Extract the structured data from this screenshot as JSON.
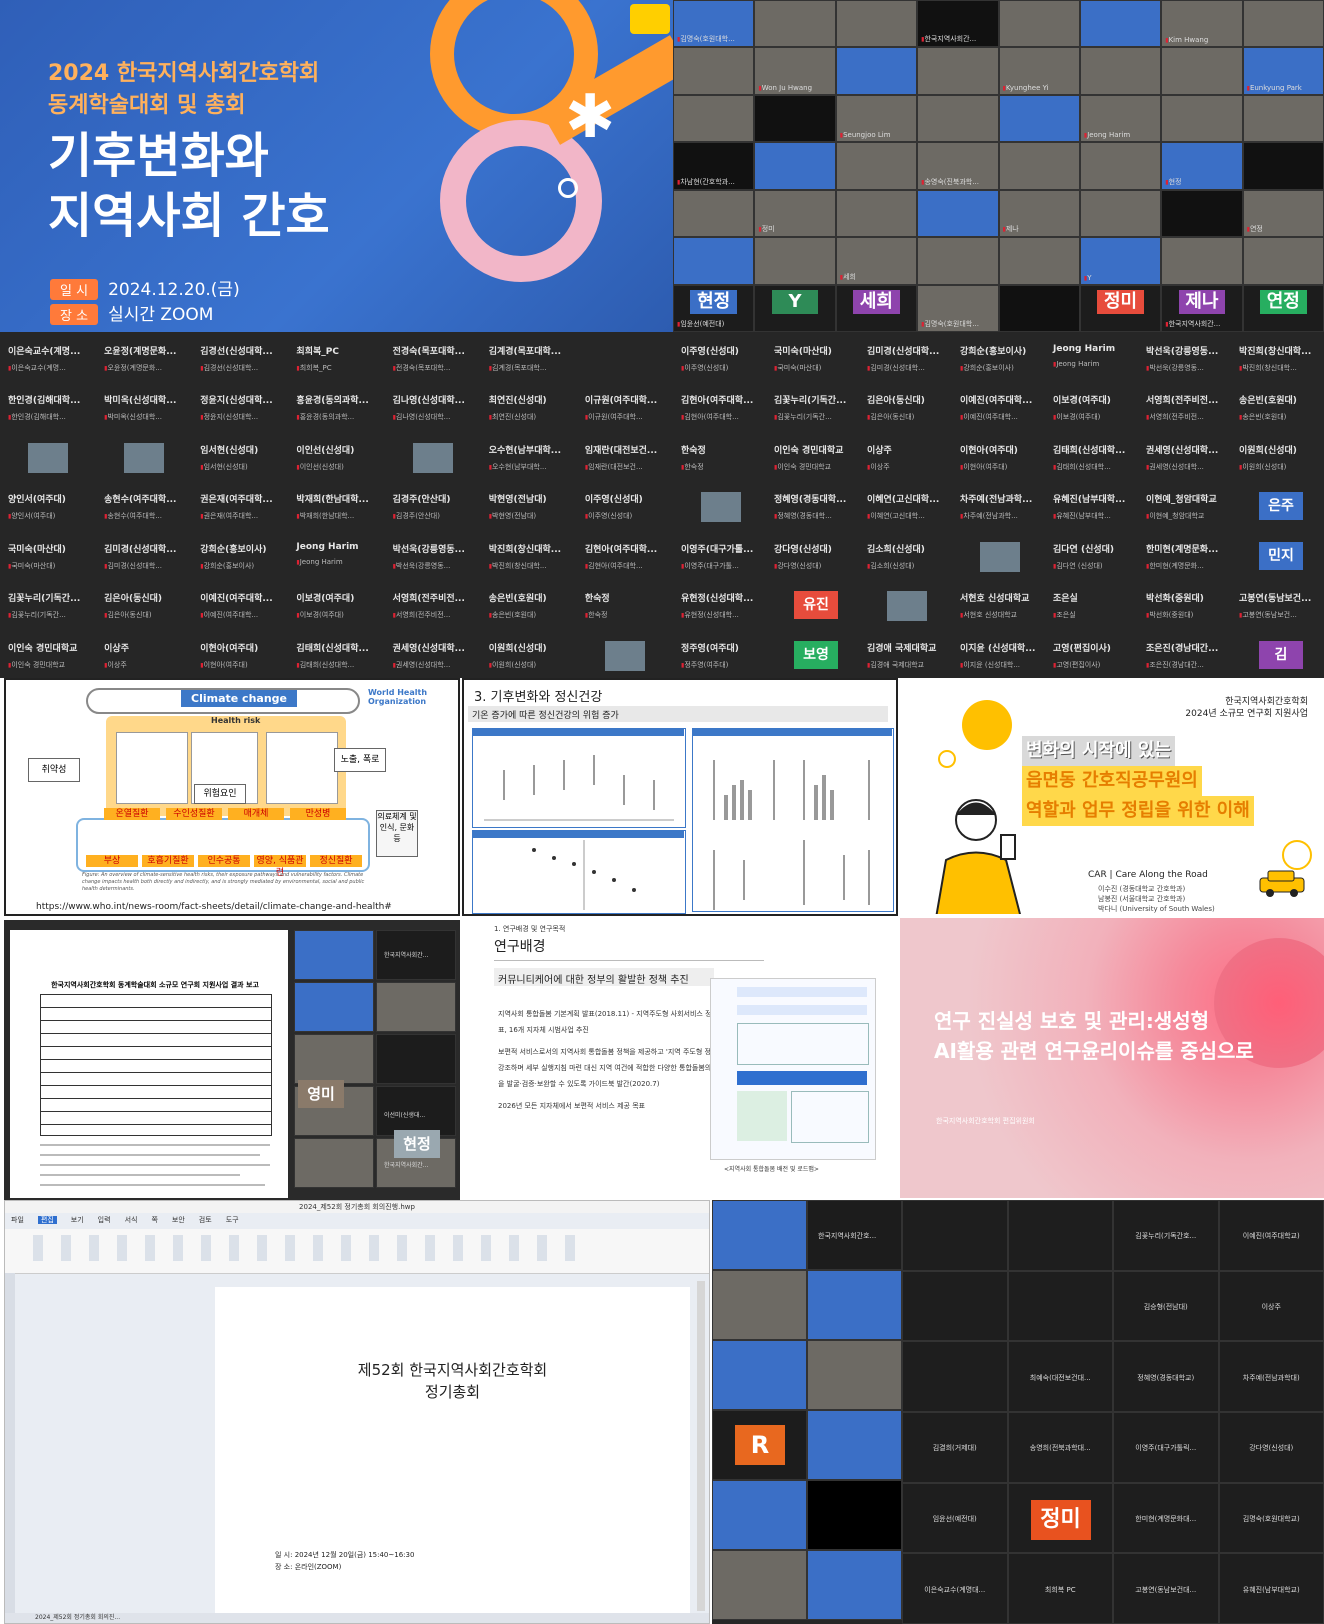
{
  "poster": {
    "line1": "2024 한국지역사회간호학회",
    "line2": "동계학술대회 및 총회",
    "title1": "기후변화와",
    "title2": "지역사회 간호",
    "date_tag": "일 시",
    "date": "2024.12.20.(금)",
    "place_tag": "장 소",
    "place": "실시간 ZOOM"
  },
  "topgrid": {
    "names": [
      "김명숙(호원대학...",
      "한국지역사회간...",
      "Kim Hwang",
      "Won Ju Hwang",
      "Kyunghee Yi",
      "Eunkyung Park",
      "Seungjoo Lim",
      "Jeong Harim",
      "차남현(간호학과...",
      "송영숙(진북과학...",
      "현정",
      "정미",
      "제나",
      "연정",
      "세희",
      "Y",
      "임윤선(예전대)"
    ],
    "avatars": [
      {
        "text": "현정",
        "color": "#3b6fc6"
      },
      {
        "text": "Y",
        "color": "#2e8b57"
      },
      {
        "text": "세희",
        "color": "#8e44ad"
      },
      {
        "text": "정미",
        "color": "#e74c3c"
      },
      {
        "text": "제나",
        "color": "#8e44ad"
      },
      {
        "text": "연정",
        "color": "#27ae60"
      }
    ]
  },
  "midgrid_left": {
    "rows": [
      [
        "이은숙교수(계명...",
        "오윤정(계명문화...",
        "김경선(신성대학...",
        "최희복_PC",
        "전경숙(목포대학...",
        "김계경(목포대학..."
      ],
      [
        "한인경(김해대학...",
        "박미옥(신성대학...",
        "정윤지(신성대학...",
        "홍윤경(동의과학...",
        "김나영(신성대학...",
        "최연진(신성대)",
        "이규원(여주대학..."
      ],
      [
        "",
        "",
        "임서현(신성대)",
        "이인선(신성대)",
        "",
        "오수현(남부대학...",
        "임재란(대전보건..."
      ],
      [
        "양인서(여주대)",
        "송현수(여주대학...",
        "권은재(여주대학...",
        "박재희(한남대학...",
        "김경주(안산대)",
        "박현영(전남대)",
        "이주영(신성대)"
      ],
      [
        "국미숙(마산대)",
        "김미경(신성대학...",
        "강희순(홍보이사)",
        "Jeong Harim",
        "박선욱(강릉영동...",
        "박진희(창신대학...",
        "김현아(여주대학..."
      ],
      [
        "김꽃누리(기독간...",
        "김은아(동신대)",
        "이예진(여주대학...",
        "이보경(여주대)",
        "서영희(전주비전...",
        "송은빈(호원대)",
        "한숙정"
      ],
      [
        "이인숙 경민대학교",
        "이상주",
        "이현아(여주대)",
        "김태희(신성대학...",
        "권세영(신성대학...",
        "이원희(신성대)",
        ""
      ]
    ]
  },
  "midgrid_right": {
    "rows": [
      [
        "이주영(신성대)",
        "국미숙(마산대)",
        "김미경(신성대학...",
        "강희순(홍보이사)",
        "Jeong Harim",
        "박선욱(강릉영동...",
        "박진희(창신대학..."
      ],
      [
        "김현아(여주대학...",
        "김꽃누리(기독간...",
        "김은아(동신대)",
        "이예진(여주대학...",
        "이보경(여주대)",
        "서영희(전주비전...",
        "송은빈(호원대)"
      ],
      [
        "한숙정",
        "이인숙 경민대학교",
        "이상주",
        "이현아(여주대)",
        "김태희(신성대학...",
        "권세영(신성대학...",
        "이원희(신성대)"
      ],
      [
        "",
        "정혜영(경동대학...",
        "이혜연(고신대학...",
        "차주예(전남과학...",
        "유혜진(남부대학...",
        "이현예_청암대학교",
        "은주"
      ],
      [
        "이영주(대구가톨...",
        "강다영(신성대)",
        "김소희(신성대)",
        "",
        "김다연 (신성대)",
        "한미현(계명문화...",
        "민지"
      ],
      [
        "유현정(신성대학...",
        "유진",
        "",
        "서현호 신성대학교",
        "조은실",
        "박선화(중원대)",
        "고봉연(동남보건..."
      ],
      [
        "정주영(여주대)",
        "보영",
        "김경애 국제대학교",
        "이지윤 (신성대학...",
        "고영(편집이사)",
        "조은진(경남대간...",
        "김"
      ]
    ],
    "avatars": [
      {
        "text": "은주",
        "color": "#3b6fc6"
      },
      {
        "text": "민지",
        "color": "#3b6fc6"
      },
      {
        "text": "유진",
        "color": "#e74c3c"
      },
      {
        "text": "보영",
        "color": "#27ae60"
      },
      {
        "text": "김",
        "color": "#8e44ad"
      }
    ]
  },
  "slide_who": {
    "banner": "Climate change",
    "org": "World Health Organization",
    "health_risk": "Health risk",
    "left_box": "취약성",
    "right_box": "노출, 폭로",
    "center_box": "위험요인",
    "far_right_box": "의료체계 및 인식, 문화 등",
    "row1": [
      "온열질환",
      "수인성질환",
      "매개체",
      "만성병"
    ],
    "row2": [
      "부상",
      "호흡기질환",
      "인수공통",
      "영양, 식품관련",
      "정신질환"
    ],
    "caption": "Figure: An overview of climate-sensitive health risks, their exposure pathways and vulnerability factors. Climate change impacts health both directly and indirectly, and is strongly mediated by environmental, social and public health determinants.",
    "url": "https://www.who.int/news-room/fact-sheets/detail/climate-change-and-health#"
  },
  "slide_mental": {
    "title": "3. 기후변화와 정신건강",
    "subtitle": "기온 증가에 따른 정신건강의 위험 증가"
  },
  "slide_care": {
    "org1": "한국지역사회간호학회",
    "org2": "2024년 소규모 연구회 지원사업",
    "title1": "변화의 시작에 있는",
    "title2": "읍면동 간호직공무원의",
    "title3": "역할과 업무 정립을 위한 이해",
    "group": "CAR | Care Along the Road",
    "member1": "이수진 (경동대학교 간호학과)",
    "member2": "남봉진 (서울대학교 간호학과)",
    "member3": "박다니 (University of South Wales)"
  },
  "slide_doc": {
    "title": "한국지역사회간호학회 동계학술대회 소규모 연구회 지원사업 결과 보고",
    "names": [
      "한국지역사회간...",
      "영미",
      "이선미(신생대...",
      "한국지역사회간...",
      "현정"
    ]
  },
  "slide_research": {
    "section": "1. 연구배경 및 연구목적",
    "title": "연구배경",
    "subtitle": "커뮤니티케어에 대한 정부의 활발한 정책 추진",
    "bullets": [
      "지역사회 통합돌봄 기본계획 발표(2018.11) - 지역주도형 사회서비스 정책 발표, 16개 지자체 시범사업 추진",
      "보편적 서비스로서의 지역사회 통합돌봄 정책을 제공하고 '지역 주도형 정책'을 강조하며 세부 실행지침 마련 대신 지역 여건에 적합한 다양한 통합돌봄의 모형을 발굴·검증·보완할 수 있도록 가이드북 발간(2020.7)",
      "2026년 모든 지자체에서 보편적 서비스 제공 목표"
    ],
    "figure_caption": "<지역사회 통합돌봄 배전 및 로드맵>"
  },
  "slide_ai": {
    "title1": "연구 진실성 보호 및 관리:생성형",
    "title2": "AI활용 관련 연구윤리이슈를 중심으로",
    "org": "한국지역사회간호학회 편집위원회"
  },
  "hwp": {
    "window_title": "2024_제52회 정기총회 회의진행.hwp",
    "menus": [
      "파일",
      "편집",
      "보기",
      "입력",
      "서식",
      "쪽",
      "보안",
      "검토",
      "도구"
    ],
    "heading1": "제52회 한국지역사회간호학회",
    "heading2": "정기총회",
    "date_line": "일 시: 2024년 12월 20일(금) 15:40~16:30",
    "place_line": "장 소: 온라인(ZOOM)",
    "status": "2024_제52회 정기총회 회의진..."
  },
  "bottom_zoom": {
    "left_names": [
      "한국지역사회간호...",
      "R"
    ],
    "right_names": [
      [
        "김꽃누리(기독간호...",
        "이예진(여주대학교)"
      ],
      [
        "김승형(전남대)",
        "이상주"
      ],
      [
        "최예숙(대전보건대...",
        "정혜영(경동대학교)",
        "차주예(전남과학대)"
      ],
      [
        "김결희(거제대)",
        "송영희(전북과학대...",
        "이영주(대구가톨릭...",
        "강다영(신성대)"
      ],
      [
        "임윤선(예전대)",
        "정미",
        "한미현(계명문화대...",
        "김명숙(호원대학교)"
      ],
      [
        "이은숙교수(계명대...",
        "최희복 PC",
        "고봉연(동남보건대...",
        "유혜진(남부대학교)"
      ]
    ]
  }
}
